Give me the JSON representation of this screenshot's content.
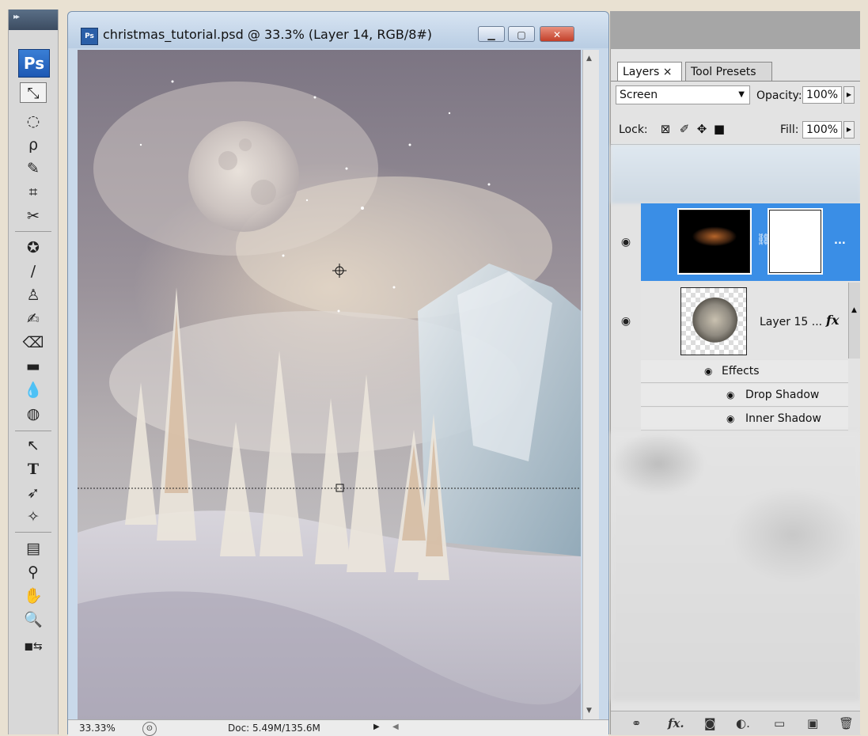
{
  "document": {
    "title": "christmas_tutorial.psd @ 33.3% (Layer 14, RGB/8#)",
    "icon_text": "Ps",
    "status_zoom": "33.33%",
    "status_doc": "Doc: 5.49M/135.6M"
  },
  "tools": {
    "logo": "Ps",
    "grip": "▸▸",
    "items": [
      "move-tool",
      "elliptical-marquee-tool",
      "lasso-tool",
      "magic-wand-tool",
      "crop-tool",
      "slice-tool",
      "spot-healing-tool",
      "brush-tool",
      "clone-stamp-tool",
      "history-brush-tool",
      "eraser-tool",
      "gradient-tool",
      "blur-tool",
      "dodge-tool",
      "path-selection-tool",
      "type-tool",
      "direct-selection-tool",
      "custom-shape-tool",
      "notes-tool",
      "eyedropper-tool",
      "hand-tool",
      "zoom-tool",
      "swap-colors-tool"
    ]
  },
  "panel": {
    "tabs": [
      {
        "label": "Layers ×"
      },
      {
        "label": "Tool Presets"
      }
    ],
    "blend_mode": "Screen",
    "opacity_label": "Opacity:",
    "opacity": "100%",
    "lock_label": "Lock:",
    "fill_label": "Fill:",
    "fill": "100%",
    "selected_layer_more": "...",
    "moon_layer_name": "Layer 15 ...",
    "fx_label": "fx",
    "effects_label": "Effects",
    "effects": [
      {
        "label": "Drop Shadow"
      },
      {
        "label": "Inner Shadow"
      }
    ],
    "bottom_icons": [
      "link-icon",
      "fx-icon",
      "mask-icon",
      "adjustment-icon",
      "folder-icon",
      "new-layer-icon",
      "trash-icon"
    ]
  },
  "colors": {
    "selection": "#3a8ee6",
    "ps_blue": "#1d58b4",
    "close_red": "#c2402a"
  }
}
